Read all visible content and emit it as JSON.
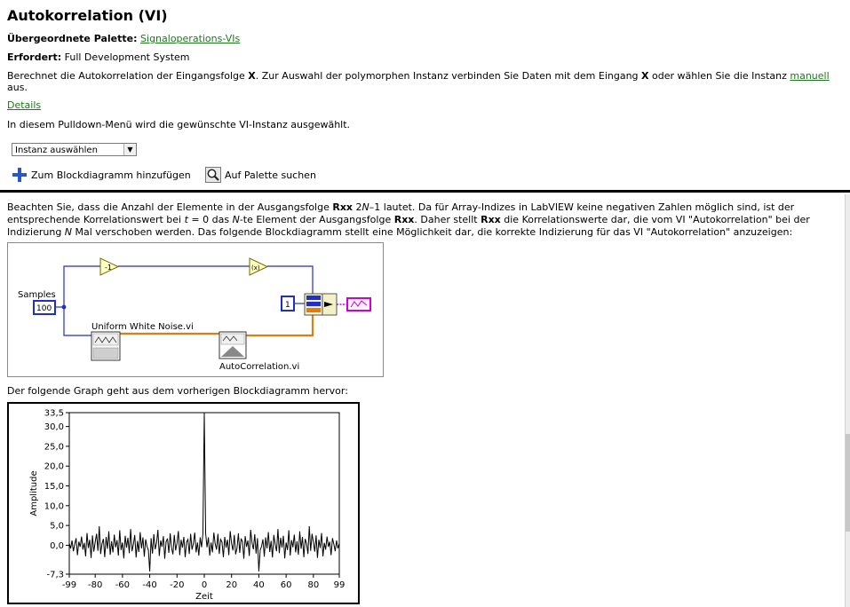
{
  "header": {
    "title": "Autokorrelation (VI)",
    "palette_label": "Übergeordnete Palette:",
    "palette_link": "Signaloperations-VIs",
    "requires_label": "Erfordert:",
    "requires_value": "Full Development System"
  },
  "description": {
    "part1": "Berechnet die Autokorrelation der Eingangsfolge ",
    "x1": "X",
    "part2": ". Zur Auswahl der polymorphen Instanz verbinden Sie Daten mit dem Eingang ",
    "x2": "X",
    "part3": " oder wählen Sie die Instanz ",
    "link": "manuell",
    "part4": " aus."
  },
  "details_link": "Details",
  "pulldown_text": "In diesem Pulldown-Menü wird die gewünschte VI-Instanz ausgewählt.",
  "instance_select": {
    "value": "Instanz auswählen"
  },
  "toolbar": {
    "add_label": "Zum Blockdiagramm hinzufügen",
    "find_label": "Auf Palette suchen"
  },
  "note": {
    "s1": "Beachten Sie, dass die Anzahl der Elemente in der Ausgangsfolge ",
    "rxx1": "Rxx",
    "s2": " 2",
    "n1": "N",
    "s3": "–1 lautet. Da für Array-Indizes in LabVIEW keine negativen Zahlen möglich sind, ist der entsprechende Korrelationswert bei ",
    "t": "t",
    "s4": " = 0 das ",
    "n2": "N",
    "s5": "-te Element der Ausgangsfolge ",
    "rxx2": "Rxx",
    "s6": ". Daher stellt ",
    "rxx3": "Rxx",
    "s7": " die Korrelationswerte dar, die vom VI \"Autokorrelation\" bei der Indizierung ",
    "n3": "N",
    "s8": " Mal verschoben werden. Das folgende Blockdiagramm stellt eine Möglichkeit dar, die korrekte Indizierung für das VI \"Autokorrelation\" anzuzeigen:"
  },
  "diagram": {
    "samples_label": "Samples",
    "samples_value": "100",
    "index_value": "1",
    "noise_vi_label": "Uniform White Noise.vi",
    "autocorr_vi_label": "AutoCorrelation.vi",
    "negate_symbol": "-1",
    "factor_symbol": "(x)"
  },
  "graph_caption": "Der folgende Graph geht aus dem vorherigen Blockdiagramm hervor:",
  "chart_data": {
    "type": "line",
    "xlabel": "Zeit",
    "ylabel": "Amplitude",
    "xlim": [
      -99,
      99
    ],
    "ylim": [
      -7.3,
      33.5
    ],
    "xticks": [
      "-99",
      "-80",
      "-60",
      "-40",
      "-20",
      "0",
      "20",
      "40",
      "60",
      "80",
      "99"
    ],
    "xtick_values": [
      -99,
      -80,
      -60,
      -40,
      -20,
      0,
      20,
      40,
      60,
      80,
      99
    ],
    "yticks": [
      "33,5",
      "30,0",
      "25,0",
      "20,0",
      "15,0",
      "10,0",
      "5,0",
      "0,0",
      "-7,3"
    ],
    "ytick_values": [
      33.5,
      30,
      25,
      20,
      15,
      10,
      5,
      0,
      -7.3
    ],
    "line_color": "#000000",
    "series": [
      {
        "x": [
          -99,
          -98,
          -97,
          -96,
          -95,
          -94,
          -93,
          -92,
          -91,
          -90,
          -89,
          -88,
          -87,
          -86,
          -85,
          -84,
          -83,
          -82,
          -81,
          -80,
          -79,
          -78,
          -77,
          -76,
          -75,
          -74,
          -73,
          -72,
          -71,
          -70,
          -69,
          -68,
          -67,
          -66,
          -65,
          -64,
          -63,
          -62,
          -61,
          -60,
          -59,
          -58,
          -57,
          -56,
          -55,
          -54,
          -53,
          -52,
          -51,
          -50,
          -49,
          -48,
          -47,
          -46,
          -45,
          -44,
          -43,
          -42,
          -41,
          -40,
          -39,
          -38,
          -37,
          -36,
          -35,
          -34,
          -33,
          -32,
          -31,
          -30,
          -29,
          -28,
          -27,
          -26,
          -25,
          -24,
          -23,
          -22,
          -21,
          -20,
          -19,
          -18,
          -17,
          -16,
          -15,
          -14,
          -13,
          -12,
          -11,
          -10,
          -9,
          -8,
          -7,
          -6,
          -5,
          -4,
          -3,
          -2,
          -1,
          0,
          1,
          2,
          3,
          4,
          5,
          6,
          7,
          8,
          9,
          10,
          11,
          12,
          13,
          14,
          15,
          16,
          17,
          18,
          19,
          20,
          21,
          22,
          23,
          24,
          25,
          26,
          27,
          28,
          29,
          30,
          31,
          32,
          33,
          34,
          35,
          36,
          37,
          38,
          39,
          40,
          41,
          42,
          43,
          44,
          45,
          46,
          47,
          48,
          49,
          50,
          51,
          52,
          53,
          54,
          55,
          56,
          57,
          58,
          59,
          60,
          61,
          62,
          63,
          64,
          65,
          66,
          67,
          68,
          69,
          70,
          71,
          72,
          73,
          74,
          75,
          76,
          77,
          78,
          79,
          80,
          81,
          82,
          83,
          84,
          85,
          86,
          87,
          88,
          89,
          90,
          91,
          92,
          93,
          94,
          95,
          96,
          97,
          98,
          99
        ],
        "values": [
          0.5,
          -0.8,
          1.2,
          -1.5,
          0.3,
          1.8,
          -2.5,
          0.9,
          -0.4,
          2.2,
          -1.1,
          0.6,
          -2.8,
          3.1,
          -0.7,
          1.4,
          -3.2,
          2.5,
          -1.6,
          0.8,
          2.9,
          -1.4,
          4.8,
          -2.2,
          0.4,
          1.6,
          -3.0,
          2.1,
          -0.9,
          3.5,
          -2.4,
          1.0,
          -1.8,
          2.7,
          -0.5,
          1.3,
          -2.6,
          3.8,
          -1.2,
          0.7,
          -3.3,
          2.4,
          -0.6,
          1.9,
          -2.0,
          4.1,
          -1.5,
          0.2,
          2.6,
          -3.1,
          1.1,
          -1.7,
          3.3,
          -0.8,
          2.0,
          -2.9,
          1.5,
          -0.3,
          -1.2,
          -6.6,
          1.8,
          -2.1,
          2.8,
          -1.0,
          0.6,
          3.9,
          -2.7,
          1.2,
          -0.4,
          2.3,
          -3.4,
          0.9,
          1.7,
          -1.9,
          3.0,
          -0.7,
          -2.3,
          2.6,
          -1.3,
          0.5,
          3.6,
          -2.5,
          1.4,
          -0.6,
          2.1,
          -3.0,
          0.8,
          1.5,
          -2.2,
          2.9,
          -1.1,
          0.4,
          3.2,
          -1.8,
          0.7,
          -2.6,
          2.0,
          -0.5,
          3.0,
          33.5,
          3.0,
          -0.5,
          2.0,
          -2.6,
          0.7,
          -1.8,
          3.2,
          0.4,
          -1.1,
          2.9,
          -2.2,
          1.5,
          0.8,
          -3.0,
          2.1,
          -0.6,
          1.4,
          -2.5,
          3.6,
          0.5,
          -1.3,
          2.6,
          -2.3,
          -0.7,
          3.0,
          -1.9,
          1.7,
          0.9,
          -3.4,
          2.3,
          -0.4,
          1.2,
          -2.7,
          3.9,
          0.6,
          -1.0,
          2.8,
          -2.1,
          1.8,
          -6.6,
          -1.2,
          -0.3,
          1.5,
          -2.9,
          2.0,
          -0.8,
          3.3,
          -1.7,
          1.1,
          -3.1,
          2.6,
          0.2,
          -1.5,
          4.1,
          -2.0,
          1.9,
          -0.6,
          2.4,
          -3.3,
          0.7,
          -1.2,
          3.8,
          -2.6,
          1.3,
          -0.5,
          2.7,
          -1.8,
          1.0,
          -2.4,
          3.5,
          -0.9,
          2.1,
          -3.0,
          1.6,
          0.4,
          -2.2,
          4.8,
          -1.4,
          2.9,
          0.8,
          -1.6,
          2.5,
          -3.2,
          1.4,
          -0.7,
          3.1,
          -2.8,
          0.6,
          -1.1,
          2.2,
          -0.4,
          0.9,
          -2.5,
          1.8,
          0.3,
          -1.5,
          1.2,
          -0.8,
          0.5
        ]
      }
    ]
  }
}
